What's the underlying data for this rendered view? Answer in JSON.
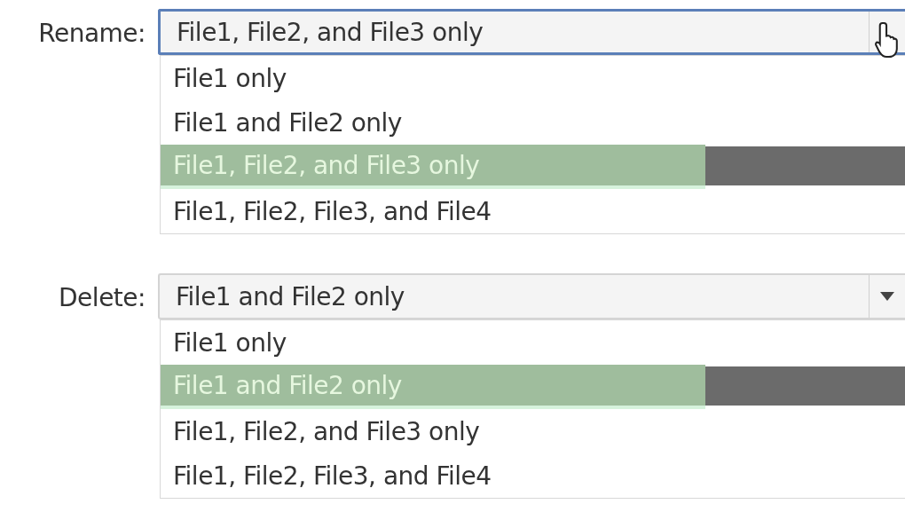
{
  "dropdowns": [
    {
      "label": "Rename:",
      "value": "File1, File2, and File3 only",
      "focused": true,
      "hovered": true,
      "items": [
        {
          "label": "File1 only",
          "selected": false
        },
        {
          "label": "File1 and File2 only",
          "selected": false
        },
        {
          "label": "File1, File2, and File3 only",
          "selected": true
        },
        {
          "label": "File1, File2, File3, and File4",
          "selected": false
        }
      ]
    },
    {
      "label": "Delete:",
      "value": "File1 and File2 only",
      "focused": false,
      "hovered": false,
      "items": [
        {
          "label": "File1 only",
          "selected": false
        },
        {
          "label": "File1 and File2 only",
          "selected": true
        },
        {
          "label": "File1, File2, and File3 only",
          "selected": false
        },
        {
          "label": "File1, File2, File3, and File4",
          "selected": false
        }
      ]
    }
  ]
}
